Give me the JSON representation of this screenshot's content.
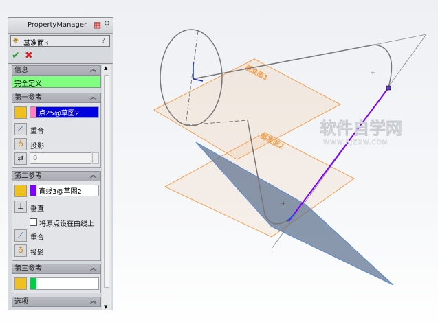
{
  "panel": {
    "title": "PropertyManager",
    "feature_name": "基准面3",
    "help": "?",
    "info": {
      "header": "信息",
      "status": "完全定义"
    },
    "ref1": {
      "header": "第一参考",
      "selection": "点25@草图2",
      "option1": "重合",
      "option2": "投影",
      "distance": "0"
    },
    "ref2": {
      "header": "第二参考",
      "selection": "直线3@草图2",
      "option1": "垂直",
      "checkbox_label": "将原点设在曲线上",
      "option2": "重合",
      "option3": "投影"
    },
    "ref3": {
      "header": "第三参考",
      "selection": ""
    },
    "options": {
      "header": "选项"
    }
  },
  "graphics": {
    "plane1_label": "基准面1",
    "plane2_label": "基准面2",
    "watermark": "软件自学网",
    "watermark_url": "WWW.RJZXW.COM"
  },
  "colors": {
    "plane": "#f0a050",
    "selection_purple": "#8000ff",
    "status_green": "#80ff80",
    "ref1_pink": "#ff80c0",
    "ref3_green": "#00cc44"
  }
}
